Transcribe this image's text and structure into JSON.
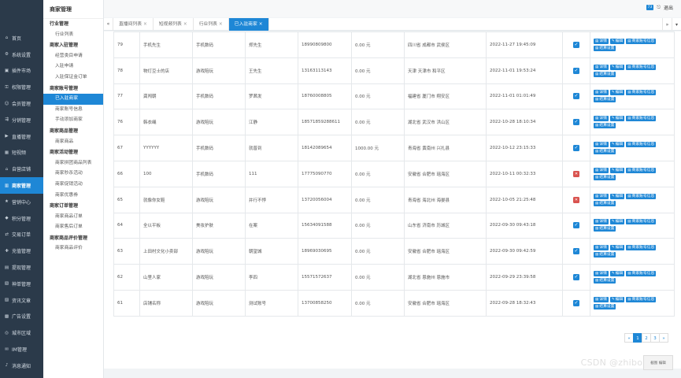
{
  "sidebar": {
    "items": [
      {
        "icon": "home-icon",
        "glyph": "⌂",
        "label": "首页",
        "active": false
      },
      {
        "icon": "gear-icon",
        "glyph": "⚙",
        "label": "系统设置",
        "active": false
      },
      {
        "icon": "puzzle-icon",
        "glyph": "▣",
        "label": "插件市场",
        "active": false
      },
      {
        "icon": "key-icon",
        "glyph": "⚿",
        "label": "权限管理",
        "active": false
      },
      {
        "icon": "users-icon",
        "glyph": "☺",
        "label": "会员管理",
        "active": false
      },
      {
        "icon": "share-icon",
        "glyph": "⇶",
        "label": "分销管理",
        "active": false
      },
      {
        "icon": "live-icon",
        "glyph": "▶",
        "label": "直播管理",
        "active": false
      },
      {
        "icon": "video-icon",
        "glyph": "▦",
        "label": "短视频",
        "active": false
      },
      {
        "icon": "store-icon",
        "glyph": "⌂",
        "label": "自营店铺",
        "active": false
      },
      {
        "icon": "merchant-icon",
        "glyph": "▥",
        "label": "商家管理",
        "active": true
      },
      {
        "icon": "marketing-icon",
        "glyph": "★",
        "label": "营销中心",
        "active": false
      },
      {
        "icon": "points-icon",
        "glyph": "◆",
        "label": "积分管理",
        "active": false
      },
      {
        "icon": "order-icon",
        "glyph": "⇄",
        "label": "交易订单",
        "active": false
      },
      {
        "icon": "recharge-icon",
        "glyph": "✚",
        "label": "充值管理",
        "active": false
      },
      {
        "icon": "withdraw-icon",
        "glyph": "▤",
        "label": "提现管理",
        "active": false
      },
      {
        "icon": "coupon-icon",
        "glyph": "▧",
        "label": "神单管理",
        "active": false
      },
      {
        "icon": "article-icon",
        "glyph": "▨",
        "label": "资讯文章",
        "active": false
      },
      {
        "icon": "ad-icon",
        "glyph": "▩",
        "label": "广告设置",
        "active": false
      },
      {
        "icon": "region-icon",
        "glyph": "◎",
        "label": "城市区域",
        "active": false
      },
      {
        "icon": "im-icon",
        "glyph": "✉",
        "label": "IM管理",
        "active": false
      },
      {
        "icon": "bell-icon",
        "glyph": "♪",
        "label": "消息通知",
        "active": false
      }
    ]
  },
  "subnav": {
    "title": "商家管理",
    "groups": [
      {
        "label": "行业管理",
        "items": [
          {
            "label": "行业列表",
            "active": false
          }
        ]
      },
      {
        "label": "商家入驻管理",
        "items": [
          {
            "label": "经营类目申请",
            "active": false
          },
          {
            "label": "入驻申请",
            "active": false
          },
          {
            "label": "入驻保证金订单",
            "active": false
          }
        ]
      },
      {
        "label": "商家账号管理",
        "items": [
          {
            "label": "已入驻商家",
            "active": true
          },
          {
            "label": "商家账号信息",
            "active": false
          },
          {
            "label": "手动添加商家",
            "active": false
          }
        ]
      },
      {
        "label": "商家商品管理",
        "items": [
          {
            "label": "商家商品",
            "active": false
          }
        ]
      },
      {
        "label": "商家活动管理",
        "items": [
          {
            "label": "商家拼团商品列表",
            "active": false
          },
          {
            "label": "商家秒杀活动",
            "active": false
          },
          {
            "label": "商家促销活动",
            "active": false
          },
          {
            "label": "商家优惠券",
            "active": false
          }
        ]
      },
      {
        "label": "商家订单管理",
        "items": [
          {
            "label": "商家商品订单",
            "active": false
          },
          {
            "label": "商家售后订单",
            "active": false
          }
        ]
      },
      {
        "label": "商家商品评价管理",
        "items": [
          {
            "label": "商家商品评价",
            "active": false
          }
        ]
      }
    ]
  },
  "topbar": {
    "badge": "73",
    "exit_label": "退出"
  },
  "tabs": [
    {
      "label": "直播间列表",
      "active": false
    },
    {
      "label": "短视频列表",
      "active": false
    },
    {
      "label": "行业列表",
      "active": false
    },
    {
      "label": "已入驻商家",
      "active": true
    }
  ],
  "table": {
    "rows": [
      {
        "id": "79",
        "name": "手机先生",
        "industry": "手机数码",
        "contact": "郑先生",
        "phone": "18990809800",
        "deposit": "0.00 元",
        "region": "四川省 成都市 武侯区",
        "time": "2022-11-27 19:45:09",
        "status": true
      },
      {
        "id": "78",
        "name": "物灯豆士的店",
        "industry": "游戏陪玩",
        "contact": "王先生",
        "phone": "13163113143",
        "deposit": "0.00 元",
        "region": "天津 天津市 和平区",
        "time": "2022-11-01 19:53:24",
        "status": true
      },
      {
        "id": "77",
        "name": "龚闯朝",
        "industry": "手机数码",
        "contact": "罗茜发",
        "phone": "18760008805",
        "deposit": "0.00 元",
        "region": "福建省 厦门市 翔安区",
        "time": "2022-11-01 01:01:49",
        "status": true
      },
      {
        "id": "76",
        "name": "韩衣绳",
        "industry": "游戏陪玩",
        "contact": "江静",
        "phone": "18571859288611",
        "deposit": "0.00 元",
        "region": "湖北省 武汉市 洪山区",
        "time": "2022-10-28 18:10:34",
        "status": true
      },
      {
        "id": "67",
        "name": "YYYYYY",
        "industry": "手机数码",
        "contact": "就普到",
        "phone": "18142089654",
        "deposit": "1000.00 元",
        "region": "青海省 黄南州 兴扎县",
        "time": "2022-10-12 23:15:33",
        "status": true
      },
      {
        "id": "66",
        "name": "100",
        "industry": "手机数码",
        "contact": "111",
        "phone": "17775090770",
        "deposit": "0.00 元",
        "region": "安徽省 合肥市 瑶海区",
        "time": "2022-10-11 00:32:33",
        "status": false
      },
      {
        "id": "65",
        "name": "就像你女鞋",
        "industry": "游戏陪玩",
        "contact": "并行不悖",
        "phone": "13720056004",
        "deposit": "0.00 元",
        "region": "青海省 海北州 海晏县",
        "time": "2022-10-05 21:25:48",
        "status": false
      },
      {
        "id": "64",
        "name": "全以平板",
        "industry": "美妆护肤",
        "contact": "在案",
        "phone": "15634091588",
        "deposit": "0.00 元",
        "region": "山东省 济南市 历城区",
        "time": "2022-09-30 09:43:18",
        "status": true
      },
      {
        "id": "63",
        "name": "上田村文化小卖部",
        "industry": "游戏陪玩",
        "contact": "朝望城",
        "phone": "18969030695",
        "deposit": "0.00 元",
        "region": "安徽省 合肥市 瑶海区",
        "time": "2022-09-30 09:42:59",
        "status": true
      },
      {
        "id": "62",
        "name": "山里人家",
        "industry": "游戏陪玩",
        "contact": "李四",
        "phone": "15571572637",
        "deposit": "0.00 元",
        "region": "湖北省 恩施州 恩施市",
        "time": "2022-09-29 23:39:58",
        "status": true
      },
      {
        "id": "61",
        "name": "店铺名称",
        "industry": "游戏陪玩",
        "contact": "测试账号",
        "phone": "13700858250",
        "deposit": "0.00 元",
        "region": "安徽省 合肥市 瑶海区",
        "time": "2022-09-28 18:32:43",
        "status": true
      }
    ],
    "buttons": {
      "detail": "详情",
      "edit": "编辑",
      "account": "商家账号信息",
      "settlement": "结算设置"
    }
  },
  "pagination": {
    "prev": "«",
    "pages": [
      "1",
      "2",
      "3"
    ],
    "current": "1",
    "next": "»"
  },
  "watermark": "CSDN @zhibosheau",
  "float_box_label": "截图 编辑",
  "colors": {
    "primary": "#1e87d6",
    "sidebar": "#2b3a4a",
    "danger": "#d9534f"
  }
}
